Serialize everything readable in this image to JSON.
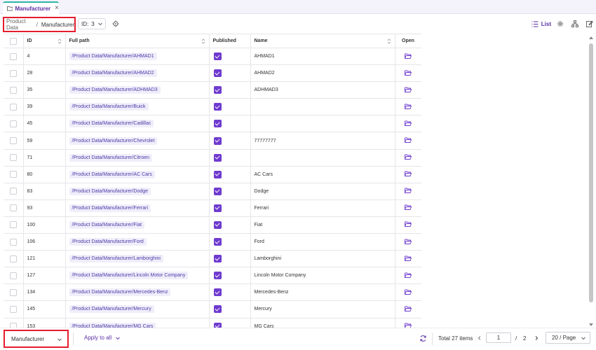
{
  "tab": {
    "title": "Manufacturer",
    "close": "×"
  },
  "breadcrumb": {
    "items": [
      "Product Data",
      "Manufacturer"
    ],
    "separator": "/"
  },
  "id_filter": {
    "label": "ID:",
    "value": "3"
  },
  "view": {
    "list_label": "List"
  },
  "table": {
    "columns": [
      "ID",
      "Full path",
      "Published",
      "Name",
      "Open"
    ],
    "rows": [
      {
        "id": "4",
        "path": "/Product Data/Manufacturer/AHMAD1",
        "published": true,
        "name": "AHMAD1"
      },
      {
        "id": "28",
        "path": "/Product Data/Manufacturer/AHMAD2",
        "published": true,
        "name": "AHMAD2"
      },
      {
        "id": "35",
        "path": "/Product Data/Manufacturer/ADHMAD3",
        "published": true,
        "name": "ADHMAD3"
      },
      {
        "id": "39",
        "path": "/Product Data/Manufacturer/Buick",
        "published": true,
        "name": ""
      },
      {
        "id": "45",
        "path": "/Product Data/Manufacturer/Cadillac",
        "published": true,
        "name": ""
      },
      {
        "id": "59",
        "path": "/Product Data/Manufacturer/Chevrolet",
        "published": true,
        "name": "77777777"
      },
      {
        "id": "71",
        "path": "/Product Data/Manufacturer/Citroen",
        "published": true,
        "name": ""
      },
      {
        "id": "80",
        "path": "/Product Data/Manufacturer/AC Cars",
        "published": true,
        "name": "AC Cars"
      },
      {
        "id": "83",
        "path": "/Product Data/Manufacturer/Dodge",
        "published": true,
        "name": "Dodge"
      },
      {
        "id": "93",
        "path": "/Product Data/Manufacturer/Ferrari",
        "published": true,
        "name": "Ferrari"
      },
      {
        "id": "100",
        "path": "/Product Data/Manufacturer/Fiat",
        "published": true,
        "name": "Fiat"
      },
      {
        "id": "106",
        "path": "/Product Data/Manufacturer/Ford",
        "published": true,
        "name": "Ford"
      },
      {
        "id": "121",
        "path": "/Product Data/Manufacturer/Lamborghini",
        "published": true,
        "name": "Lamborghini"
      },
      {
        "id": "127",
        "path": "/Product Data/Manufacturer/Lincoln Motor Company",
        "published": true,
        "name": "Lincoln Motor Company"
      },
      {
        "id": "134",
        "path": "/Product Data/Manufacturer/Mercedes-Benz",
        "published": true,
        "name": "Mercedes-Benz"
      },
      {
        "id": "145",
        "path": "/Product Data/Manufacturer/Mercury",
        "published": true,
        "name": "Mercury"
      },
      {
        "id": "153",
        "path": "/Product Data/Manufacturer/MG Cars",
        "published": true,
        "name": "MG Cars"
      }
    ]
  },
  "footer": {
    "class_select": "Manufacturer",
    "apply_all": "Apply to all",
    "total": "Total 27 items",
    "current_page": "1",
    "page_sep": "/",
    "total_pages": "2",
    "per_page": "20 / Page"
  },
  "colors": {
    "accent": "#6f3bcf",
    "highlight_border": "#e41d2d",
    "tab_top": "#2fb5a6"
  }
}
